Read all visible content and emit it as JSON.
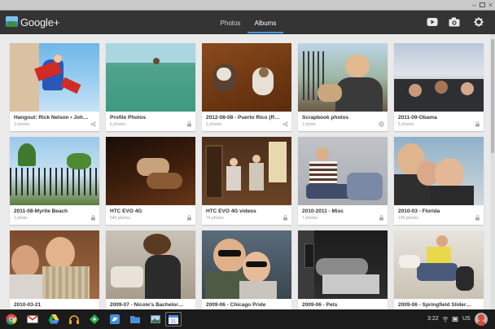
{
  "app": {
    "brand": "Google+",
    "tabs": [
      {
        "label": "Photos",
        "active": false
      },
      {
        "label": "Albums",
        "active": true
      }
    ],
    "accent_color": "#3f96e8"
  },
  "header_icons": [
    "youtube-icon",
    "camera-icon",
    "gear-icon"
  ],
  "albums": [
    {
      "title": "Hangout: Rick Nelson • John...",
      "count": "3 photos",
      "badge": "share-icon"
    },
    {
      "title": "Profile Photos",
      "count": "6 photos",
      "badge": "lock-icon"
    },
    {
      "title": "2012-08-08 - Puerto Rico (Ric...",
      "count": "5 photos",
      "badge": "share-icon"
    },
    {
      "title": "Scrapbook photos",
      "count": "1 photo",
      "badge": "globe-icon"
    },
    {
      "title": "2011-09-Obama",
      "count": "5 photos",
      "badge": "lock-icon"
    },
    {
      "title": "2011-08-Myrtle Beach",
      "count": "1 photo",
      "badge": "lock-icon"
    },
    {
      "title": "HTC EVO 4G",
      "count": "640 photos",
      "badge": "lock-icon"
    },
    {
      "title": "HTC EVO 4G videos",
      "count": "74 photos",
      "badge": "lock-icon"
    },
    {
      "title": "2010-2011 - Misc",
      "count": "7 photos",
      "badge": "lock-icon"
    },
    {
      "title": "2010-03 - Florida",
      "count": "100 photos",
      "badge": "lock-icon"
    },
    {
      "title": "2010-03-21",
      "count": "",
      "badge": ""
    },
    {
      "title": "2009-07 - Nicole's Bachelore...",
      "count": "",
      "badge": ""
    },
    {
      "title": "2009-06 - Chicago Pride",
      "count": "",
      "badge": ""
    },
    {
      "title": "2009-06 - Pets",
      "count": "",
      "badge": ""
    },
    {
      "title": "2009-06 - Springfield Sliders...",
      "count": "",
      "badge": ""
    }
  ],
  "taskbar": {
    "apps": [
      "chrome-icon",
      "gmail-icon",
      "drive-icon",
      "music-icon",
      "feedly-icon",
      "tweetdeck-icon",
      "files-icon",
      "photos-icon",
      "calendar-icon"
    ],
    "time": "3:22",
    "locale": "US"
  }
}
